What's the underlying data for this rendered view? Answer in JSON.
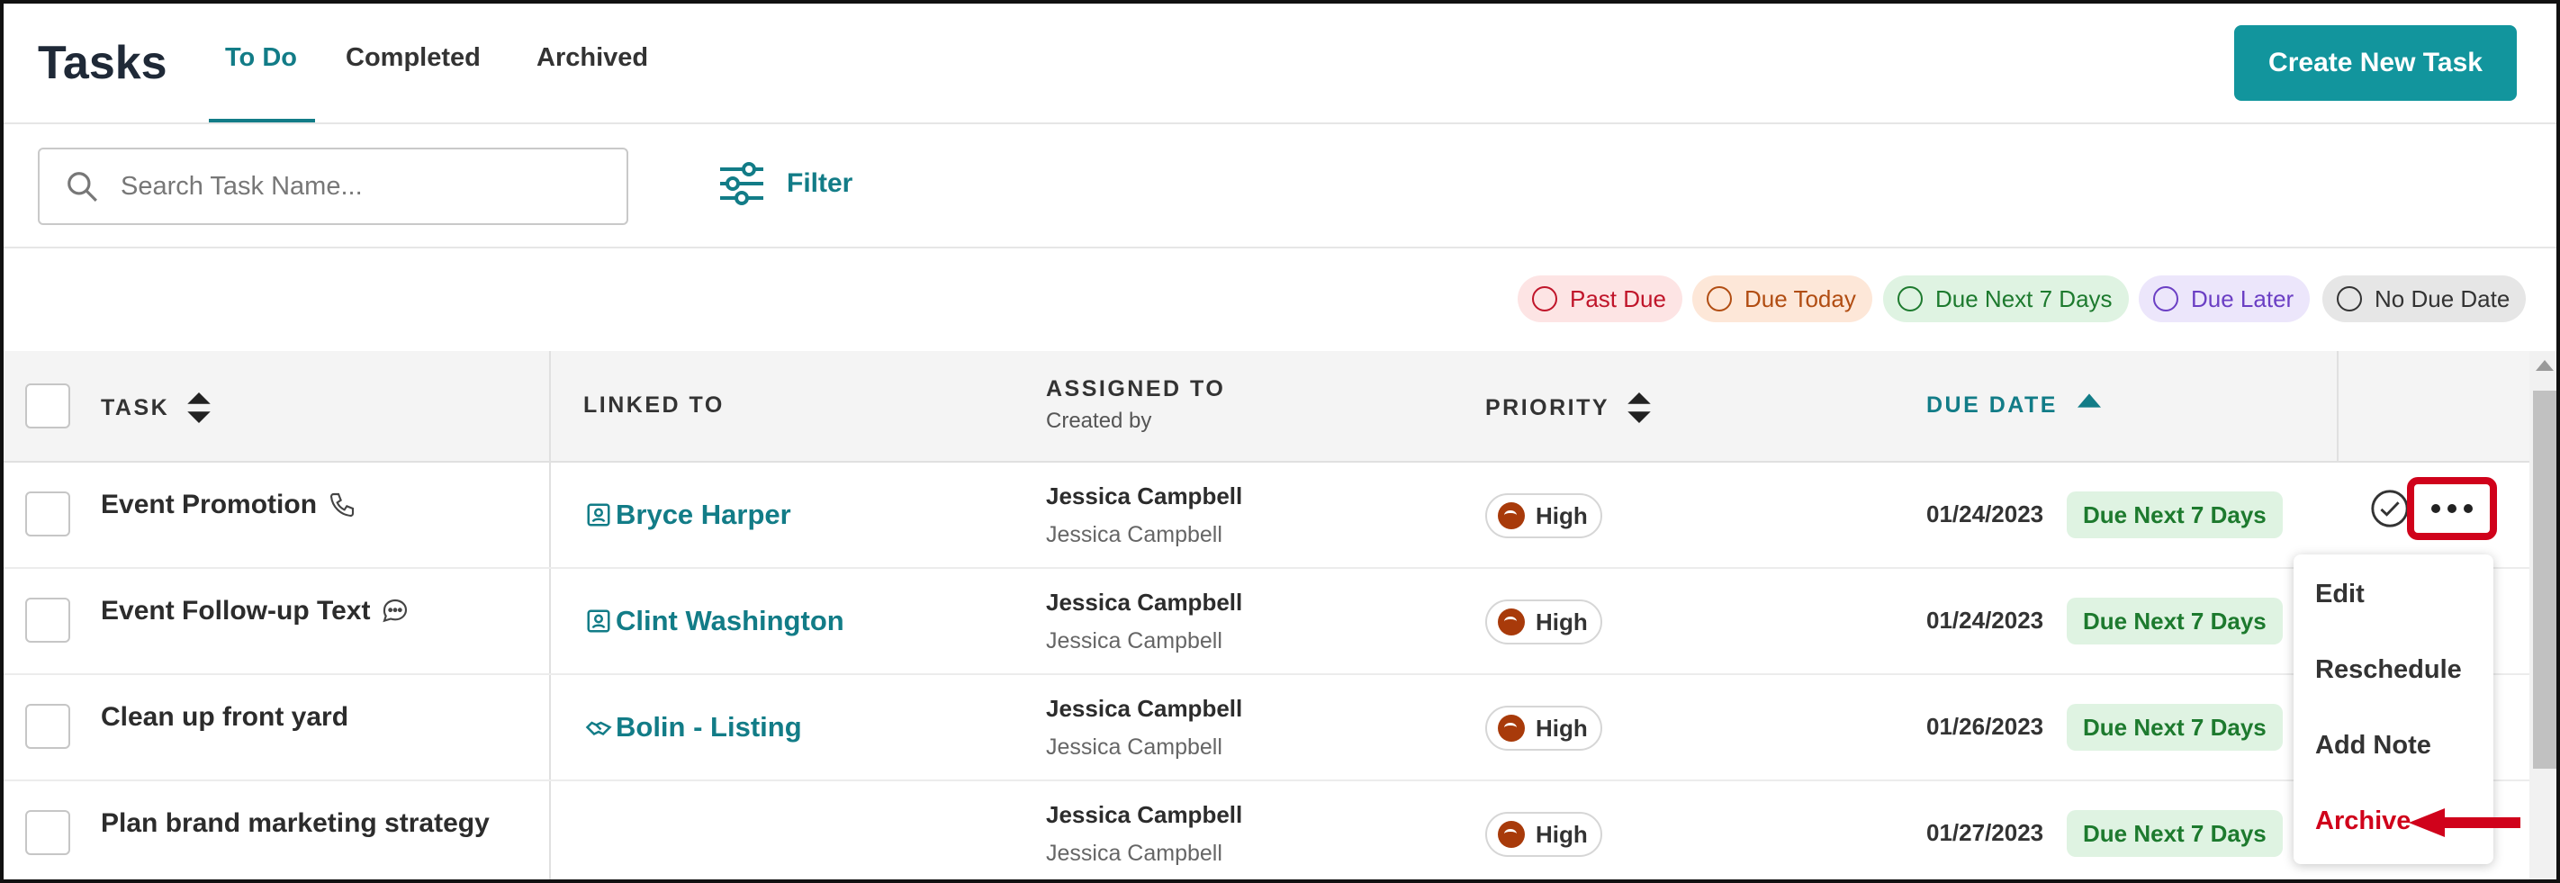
{
  "header": {
    "title": "Tasks",
    "tabs": [
      {
        "label": "To Do",
        "active": true
      },
      {
        "label": "Completed",
        "active": false
      },
      {
        "label": "Archived",
        "active": false
      }
    ],
    "create_button": "Create New Task"
  },
  "toolbar": {
    "search_placeholder": "Search Task Name...",
    "filter_label": "Filter"
  },
  "legend": [
    {
      "label": "Past Due",
      "bg": "#fde4e4",
      "color": "#c0152a"
    },
    {
      "label": "Due Today",
      "bg": "#fde7d8",
      "color": "#b14d12"
    },
    {
      "label": "Due Next 7 Days",
      "bg": "#dff3e2",
      "color": "#1d7a2e"
    },
    {
      "label": "Due Later",
      "bg": "#ece6fb",
      "color": "#6b3fc4"
    },
    {
      "label": "No Due Date",
      "bg": "#e6e6e6",
      "color": "#333333"
    }
  ],
  "table": {
    "columns": {
      "task": "TASK",
      "linked": "LINKED TO",
      "assigned": "ASSIGNED TO",
      "created_by": "Created by",
      "priority": "PRIORITY",
      "due_date": "DUE DATE"
    },
    "rows": [
      {
        "task": "Event Promotion",
        "task_icon": "phone-icon",
        "linked": "Bryce Harper",
        "linked_icon": "contact-icon",
        "assigned": "Jessica Campbell",
        "created": "Jessica Campbell",
        "priority": "High",
        "due": "01/24/2023",
        "status": "Due Next 7 Days"
      },
      {
        "task": "Event Follow-up Text",
        "task_icon": "chat-icon",
        "linked": "Clint Washington",
        "linked_icon": "contact-icon",
        "assigned": "Jessica Campbell",
        "created": "Jessica Campbell",
        "priority": "High",
        "due": "01/24/2023",
        "status": "Due Next 7 Days"
      },
      {
        "task": "Clean up front yard",
        "task_icon": "",
        "linked": "Bolin - Listing",
        "linked_icon": "handshake-icon",
        "assigned": "Jessica Campbell",
        "created": "Jessica Campbell",
        "priority": "High",
        "due": "01/26/2023",
        "status": "Due Next 7 Days"
      },
      {
        "task": "Plan brand marketing strategy",
        "task_icon": "",
        "linked": "",
        "linked_icon": "",
        "assigned": "Jessica Campbell",
        "created": "Jessica Campbell",
        "priority": "High",
        "due": "01/27/2023",
        "status": "Due Next 7 Days"
      }
    ]
  },
  "menu": {
    "items": [
      "Edit",
      "Reschedule",
      "Add Note",
      "Archive"
    ]
  },
  "colors": {
    "accent": "#127c87",
    "button": "#12959d",
    "highlight": "#d0021b"
  }
}
